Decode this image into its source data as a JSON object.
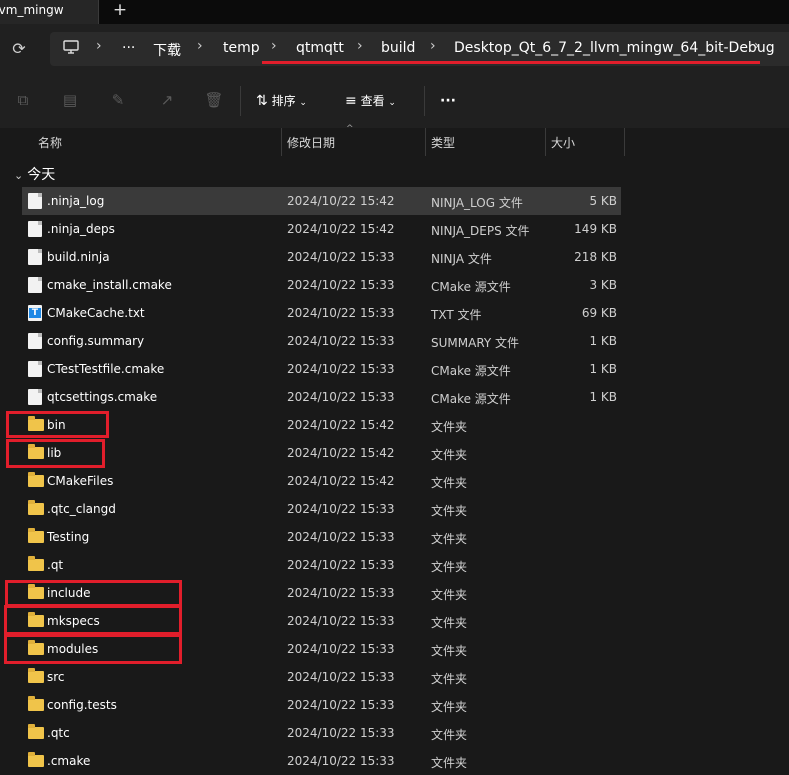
{
  "window": {
    "tab_title": "llvm_mingw"
  },
  "colors": {
    "accent_highlight": "#e11e2b",
    "background": "#191919",
    "folder": "#f0c44a"
  },
  "address_bar": {
    "overflow": "···",
    "crumbs": [
      "下载",
      "temp",
      "qtmqtt",
      "build",
      "Desktop_Qt_6_7_2_llvm_mingw_64_bit-Debug"
    ]
  },
  "toolbar": {
    "sort_label": "排序",
    "view_label": "查看",
    "more_label": "···"
  },
  "columns": {
    "name": "名称",
    "date": "修改日期",
    "type": "类型",
    "size": "大小"
  },
  "group": {
    "label": "今天"
  },
  "rows": [
    {
      "name": ".ninja_log",
      "date": "2024/10/22 15:42",
      "type": "NINJA_LOG 文件",
      "size": "5 KB",
      "icon": "file-icon"
    },
    {
      "name": ".ninja_deps",
      "date": "2024/10/22 15:42",
      "type": "NINJA_DEPS 文件",
      "size": "149 KB",
      "icon": "file-icon"
    },
    {
      "name": "build.ninja",
      "date": "2024/10/22 15:33",
      "type": "NINJA 文件",
      "size": "218 KB",
      "icon": "file-icon"
    },
    {
      "name": "cmake_install.cmake",
      "date": "2024/10/22 15:33",
      "type": "CMake 源文件",
      "size": "3 KB",
      "icon": "file-icon"
    },
    {
      "name": "CMakeCache.txt",
      "date": "2024/10/22 15:33",
      "type": "TXT 文件",
      "size": "69 KB",
      "icon": "text-file-icon"
    },
    {
      "name": "config.summary",
      "date": "2024/10/22 15:33",
      "type": "SUMMARY 文件",
      "size": "1 KB",
      "icon": "file-icon"
    },
    {
      "name": "CTestTestfile.cmake",
      "date": "2024/10/22 15:33",
      "type": "CMake 源文件",
      "size": "1 KB",
      "icon": "file-icon"
    },
    {
      "name": "qtcsettings.cmake",
      "date": "2024/10/22 15:33",
      "type": "CMake 源文件",
      "size": "1 KB",
      "icon": "file-icon"
    },
    {
      "name": "bin",
      "date": "2024/10/22 15:42",
      "type": "文件夹",
      "size": "",
      "icon": "folder-icon"
    },
    {
      "name": "lib",
      "date": "2024/10/22 15:42",
      "type": "文件夹",
      "size": "",
      "icon": "folder-icon"
    },
    {
      "name": "CMakeFiles",
      "date": "2024/10/22 15:42",
      "type": "文件夹",
      "size": "",
      "icon": "folder-icon"
    },
    {
      "name": ".qtc_clangd",
      "date": "2024/10/22 15:33",
      "type": "文件夹",
      "size": "",
      "icon": "folder-icon"
    },
    {
      "name": "Testing",
      "date": "2024/10/22 15:33",
      "type": "文件夹",
      "size": "",
      "icon": "folder-icon"
    },
    {
      "name": ".qt",
      "date": "2024/10/22 15:33",
      "type": "文件夹",
      "size": "",
      "icon": "folder-icon"
    },
    {
      "name": "include",
      "date": "2024/10/22 15:33",
      "type": "文件夹",
      "size": "",
      "icon": "folder-icon"
    },
    {
      "name": "mkspecs",
      "date": "2024/10/22 15:33",
      "type": "文件夹",
      "size": "",
      "icon": "folder-icon"
    },
    {
      "name": "modules",
      "date": "2024/10/22 15:33",
      "type": "文件夹",
      "size": "",
      "icon": "folder-icon"
    },
    {
      "name": "src",
      "date": "2024/10/22 15:33",
      "type": "文件夹",
      "size": "",
      "icon": "folder-icon"
    },
    {
      "name": "config.tests",
      "date": "2024/10/22 15:33",
      "type": "文件夹",
      "size": "",
      "icon": "folder-icon"
    },
    {
      "name": ".qtc",
      "date": "2024/10/22 15:33",
      "type": "文件夹",
      "size": "",
      "icon": "folder-icon"
    },
    {
      "name": ".cmake",
      "date": "2024/10/22 15:33",
      "type": "文件夹",
      "size": "",
      "icon": "folder-icon"
    }
  ]
}
